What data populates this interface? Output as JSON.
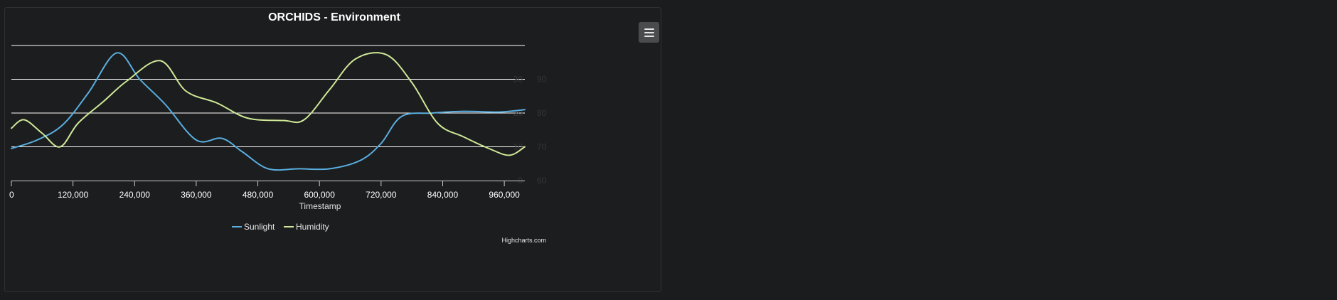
{
  "chart_data": {
    "type": "line",
    "title": "ORCHIDS - Environment",
    "xlabel": "Timestamp",
    "xlim": [
      0,
      1000000
    ],
    "x_ticks": [
      0,
      120000,
      240000,
      360000,
      480000,
      600000,
      720000,
      840000,
      960000
    ],
    "x_tick_labels": [
      "0",
      "120,000",
      "240,000",
      "360,000",
      "480,000",
      "600,000",
      "720,000",
      "840,000",
      "960,000"
    ],
    "y_axis_right": {
      "range": [
        60,
        104
      ],
      "ticks": [
        60,
        70,
        80,
        90
      ],
      "tick_labels": [
        "60",
        "70",
        "80",
        "90"
      ]
    },
    "y_axis_inner": {
      "range": [
        0,
        44
      ],
      "ticks": [
        0,
        10,
        20,
        30
      ],
      "tick_labels": [
        "0",
        "10",
        "20",
        "30"
      ]
    },
    "grid": true,
    "legend_position": "bottom-center",
    "series": [
      {
        "name": "Sunlight",
        "color": "#5aaee0",
        "x": [
          0,
          50000,
          100000,
          150000,
          205000,
          250000,
          300000,
          360000,
          410000,
          450000,
          500000,
          560000,
          620000,
          680000,
          720000,
          760000,
          820000,
          880000,
          950000,
          1000000
        ],
        "y": [
          69.5,
          72,
          76.5,
          86,
          97.8,
          90,
          82.5,
          72,
          72.5,
          68.5,
          63.5,
          63.5,
          63.5,
          66,
          71,
          79,
          80,
          80.5,
          80.3,
          81
        ]
      },
      {
        "name": "Humidity",
        "color": "#cfe898",
        "x": [
          0,
          25000,
          60000,
          95000,
          130000,
          180000,
          225000,
          290000,
          340000,
          400000,
          460000,
          530000,
          570000,
          620000,
          670000,
          730000,
          780000,
          830000,
          880000,
          930000,
          970000,
          1000000
        ],
        "y": [
          75.5,
          78,
          74,
          70,
          77,
          83.5,
          89.5,
          95.5,
          86.5,
          83,
          78.5,
          77.8,
          78,
          87,
          96,
          97.3,
          89,
          77,
          73,
          69.5,
          67.5,
          70
        ]
      }
    ]
  },
  "credits": "Highcharts.com"
}
